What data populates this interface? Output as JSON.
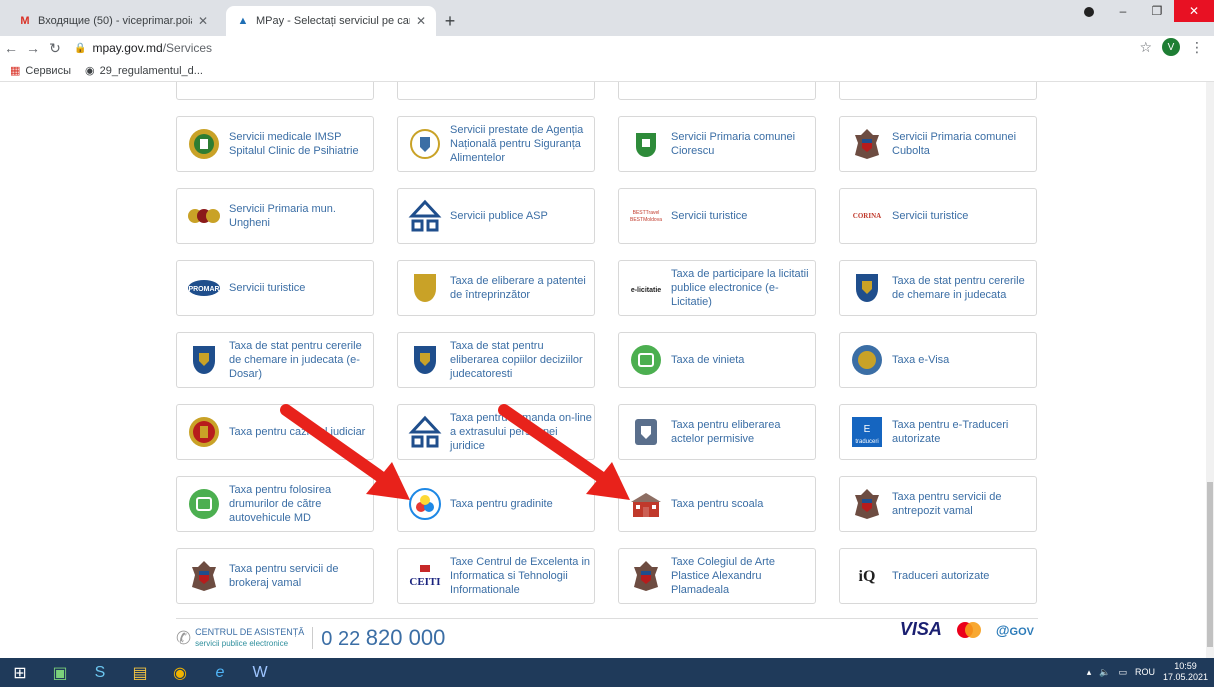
{
  "browser": {
    "tabs": [
      {
        "title": "Входящие (50) - viceprimar.poia",
        "icon": "gmail-icon",
        "active": false
      },
      {
        "title": "MPay - Selectați serviciul pe care",
        "icon": "mpay-icon",
        "active": true
      }
    ],
    "url_host": "mpay.gov.md",
    "url_path": "/Services",
    "profile_initial": "V",
    "bookmarks": [
      "Сервисы",
      "29_regulamentul_d..."
    ]
  },
  "services": [
    {
      "label": "Servicii medicale IMSP Spitalul Clinic de Psihiatrie",
      "icon": "hospital-emblem-icon",
      "color": "#c9a227"
    },
    {
      "label": "Servicii prestate de Agenția Națională pentru Siguranța Alimentelor",
      "icon": "ansa-emblem-icon",
      "color": "#3b6ea5"
    },
    {
      "label": "Servicii Primaria comunei Ciorescu",
      "icon": "ciorescu-emblem-icon",
      "color": "#2e8b3a"
    },
    {
      "label": "Servicii Primaria comunei Cubolta",
      "icon": "moldova-coat-of-arms-icon",
      "color": "#8b1a1a"
    },
    {
      "label": "Servicii Primaria mun. Ungheni",
      "icon": "ungheni-emblem-icon",
      "color": "#8b1a1a"
    },
    {
      "label": "Servicii publice ASP",
      "icon": "asp-logo-icon",
      "color": "#1f4e8c"
    },
    {
      "label": "Servicii turistice",
      "icon": "best-travel-logo-icon",
      "color": "#c0392b"
    },
    {
      "label": "Servicii turistice",
      "icon": "corina-logo-icon",
      "color": "#2e7d32"
    },
    {
      "label": "Servicii turistice",
      "icon": "promar-logo-icon",
      "color": "#1f4e8c"
    },
    {
      "label": "Taxa de eliberare a patentei de întreprinzător",
      "icon": "shield-emblem-icon",
      "color": "#c9a227"
    },
    {
      "label": "Taxa de participare la licitatii publice electronice (e-Licitatie)",
      "icon": "e-licitatie-logo-icon",
      "color": "#333333"
    },
    {
      "label": "Taxa de stat pentru cererile de chemare in judecata",
      "icon": "justice-emblem-icon",
      "color": "#1f4e8c"
    },
    {
      "label": "Taxa de stat pentru cererile de chemare in judecata (e-Dosar)",
      "icon": "justice-emblem-icon",
      "color": "#1f4e8c"
    },
    {
      "label": "Taxa de stat pentru eliberarea copiilor deciziilor judecatoresti",
      "icon": "justice-emblem-icon",
      "color": "#1f4e8c"
    },
    {
      "label": "Taxa de vinieta",
      "icon": "vignette-icon",
      "color": "#4caf50"
    },
    {
      "label": "Taxa e-Visa",
      "icon": "evisa-emblem-icon",
      "color": "#3b6ea5"
    },
    {
      "label": "Taxa pentru cazierul judiciar",
      "icon": "police-emblem-icon",
      "color": "#b71c1c"
    },
    {
      "label": "Taxa pentru comanda on-line a extrasului persoanei juridice",
      "icon": "asp-logo-icon",
      "color": "#1f4e8c"
    },
    {
      "label": "Taxa pentru eliberarea actelor permisive",
      "icon": "permits-emblem-icon",
      "color": "#5a6f8c"
    },
    {
      "label": "Taxa pentru e-Traduceri autorizate",
      "icon": "traduceri-logo-icon",
      "color": "#1565c0"
    },
    {
      "label": "Taxa pentru folosirea drumurilor de către autovehicule MD",
      "icon": "vignette-icon",
      "color": "#4caf50"
    },
    {
      "label": "Taxa pentru gradinite",
      "icon": "kindergarten-icon",
      "color": "#1e88e5"
    },
    {
      "label": "Taxa pentru scoala",
      "icon": "school-building-icon",
      "color": "#c0392b"
    },
    {
      "label": "Taxa pentru servicii de antrepozit vamal",
      "icon": "moldova-coat-of-arms-icon",
      "color": "#8b1a1a"
    },
    {
      "label": "Taxa pentru servicii de brokeraj vamal",
      "icon": "moldova-coat-of-arms-icon",
      "color": "#8b1a1a"
    },
    {
      "label": "Taxe Centrul de Excelenta in Informatica si Tehnologii Informationale",
      "icon": "ceiti-logo-icon",
      "color": "#1a237e"
    },
    {
      "label": "Taxe Colegiul de Arte Plastice Alexandru Plamadeala",
      "icon": "moldova-coat-of-arms-icon",
      "color": "#8b1a1a"
    },
    {
      "label": "Traduceri autorizate",
      "icon": "iq-logo-icon",
      "color": "#222222"
    }
  ],
  "logo_text": {
    "best_travel": "BESTTravel BESTMoldova",
    "corina": "CORINA",
    "promar": "PROMAR",
    "e_licitatie": "e-licitatie",
    "traduceri": "traduceri",
    "traduceri_letter": "E",
    "ceiti": "CEITI",
    "iq": "iQ"
  },
  "footer": {
    "help_title": "CENTRUL DE ASISTENȚĂ",
    "help_subtitle": "servicii publice electronice",
    "phone_prefix": "0 22",
    "phone_number": "820 000",
    "visa": "VISA",
    "gov": "GOV"
  },
  "taskbar": {
    "language": "ROU",
    "time": "10:59",
    "date": "17.05.2021"
  },
  "colors": {
    "link": "#3b6ea5",
    "arrow": "#e8221b",
    "taskbar": "#1f3a5a"
  }
}
